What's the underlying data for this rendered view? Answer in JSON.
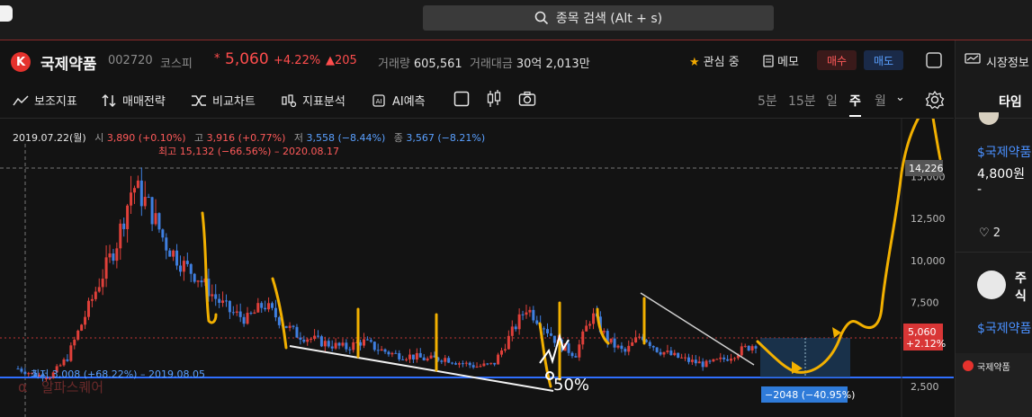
{
  "search": {
    "placeholder": "종목 검색 (Alt + s)"
  },
  "stock": {
    "name": "국제약품",
    "code": "002720",
    "market": "코스피",
    "star": "*",
    "price": "5,060",
    "change_pct": "+4.22%",
    "change_abs": "▲205",
    "volume_label": "거래량",
    "volume": "605,561",
    "amount_label": "거래대금",
    "amount": "30억 2,013만"
  },
  "actions": {
    "watch": "관심 중",
    "memo": "메모",
    "buy": "매수",
    "sell": "매도",
    "market_info": "시장정보"
  },
  "toolbar": {
    "tools": [
      "보조지표",
      "매매전략",
      "비교차트",
      "지표분석",
      "AI예측"
    ],
    "periods": [
      "5분",
      "15분",
      "일",
      "주",
      "월"
    ],
    "active_period": "주"
  },
  "ohlc": {
    "date": "2019.07.22(월)",
    "open_label": "시",
    "open": "3,890 (+0.10%)",
    "high_label": "고",
    "high": "3,916 (+0.77%)",
    "low_label": "저",
    "low": "3,558 (−8.44%)",
    "close_label": "종",
    "close": "3,567 (−8.21%)"
  },
  "chart_data": {
    "type": "candlestick",
    "y_ticks": [
      "15,000",
      "12,500",
      "10,000",
      "7,500",
      "5,000",
      "2,500"
    ],
    "ylim": [
      2000,
      17000
    ],
    "current_price_label": "5,060",
    "current_change_label": "+2.12%",
    "crosshair_label": "14,226",
    "max_annotation": "최고 15,132 (−66.56%) – 2020.08.17",
    "min_annotation": "최저 3,008 (+68.22%) – 2019.08.05",
    "measure_label": "−2048 (−40.95%)",
    "handwritten_note": "50%",
    "series_weekly_close": [
      3567,
      3200,
      3100,
      4200,
      6500,
      8800,
      11000,
      14500,
      13200,
      11000,
      9800,
      9000,
      7800,
      6900,
      6500,
      7400,
      6400,
      5600,
      5300,
      5000,
      4800,
      5200,
      4700,
      4400,
      4300,
      4100,
      4200,
      3900,
      3700,
      3800,
      5500,
      7200,
      6200,
      5000,
      4400,
      6800,
      5200,
      4500,
      5600,
      4700,
      4300,
      4000,
      3800,
      4100,
      4600,
      5060
    ]
  },
  "watermark": "알파스퀘어",
  "right_panel": {
    "tab": "타임",
    "post1": {
      "ticker": "$국제약품",
      "price": "4,800원 -",
      "likes": "2"
    },
    "post2": {
      "user": "주식",
      "ticker": "$국제약품"
    },
    "mini_title": "국제약품"
  }
}
